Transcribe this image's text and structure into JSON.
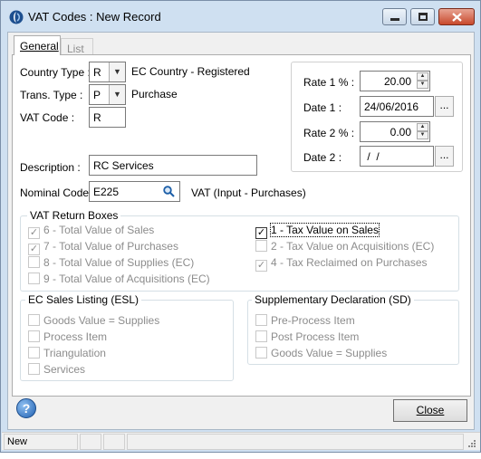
{
  "window": {
    "title": "VAT Codes : New Record",
    "minimize_glyph": "—",
    "maximize_glyph": "□",
    "close_glyph": "✕"
  },
  "tabs": [
    {
      "label": "General"
    },
    {
      "label": "List"
    }
  ],
  "form": {
    "country_type": {
      "label": "Country Type :",
      "value": "R",
      "description": "EC Country - Registered"
    },
    "trans_type": {
      "label": "Trans. Type :",
      "value": "P",
      "description": "Purchase"
    },
    "vat_code": {
      "label": "VAT Code :",
      "value": "R"
    },
    "description": {
      "label": "Description :",
      "value": "RC Services"
    },
    "nominal_code": {
      "label": "Nominal Code :",
      "value": "E225",
      "description": "VAT (Input - Purchases)"
    },
    "rate1": {
      "label": "Rate 1 % :",
      "value": "20.00"
    },
    "date1": {
      "label": "Date 1 :",
      "value": "24/06/2016"
    },
    "rate2": {
      "label": "Rate 2 % :",
      "value": "0.00"
    },
    "date2": {
      "label": "Date 2 :",
      "value": " /  /"
    },
    "dots": "..."
  },
  "vat_return": {
    "title": "VAT Return Boxes",
    "left": [
      {
        "label": "6 - Total Value of Sales",
        "checked": true
      },
      {
        "label": "7 - Total Value of Purchases",
        "checked": true
      },
      {
        "label": "8 - Total Value of Supplies (EC)",
        "checked": false
      },
      {
        "label": "9 - Total Value of Acquisitions (EC)",
        "checked": false
      }
    ],
    "right": [
      {
        "label": "1 - Tax Value on Sales",
        "checked": true
      },
      {
        "label": "2 - Tax Value on Acquisitions (EC)",
        "checked": false
      },
      {
        "label": "4 - Tax Reclaimed on Purchases",
        "checked": true
      }
    ]
  },
  "esl": {
    "title": "EC Sales Listing (ESL)",
    "items": [
      {
        "label": "Goods Value = Supplies"
      },
      {
        "label": "Process Item"
      },
      {
        "label": "Triangulation"
      },
      {
        "label": "Services"
      }
    ]
  },
  "sd": {
    "title": "Supplementary Declaration (SD)",
    "items": [
      {
        "label": "Pre-Process Item"
      },
      {
        "label": "Post Process Item"
      },
      {
        "label": "Goods Value = Supplies"
      }
    ]
  },
  "buttons": {
    "help": "?",
    "close": "Close"
  },
  "status_bar": {
    "mode": "New"
  }
}
